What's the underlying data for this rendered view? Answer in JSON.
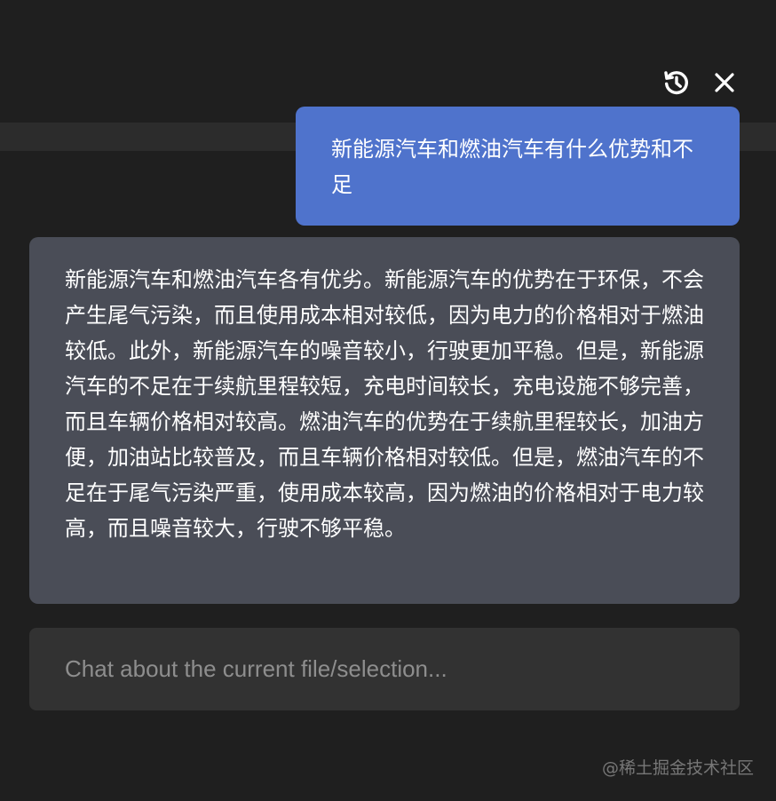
{
  "toolbar": {
    "history_icon": "history-icon",
    "close_icon": "close-icon",
    "icon_color": "#ffffff"
  },
  "messages": [
    {
      "role": "user",
      "text": "新能源汽车和燃油汽车有什么优势和不足"
    },
    {
      "role": "assistant",
      "text": "新能源汽车和燃油汽车各有优劣。新能源汽车的优势在于环保，不会产生尾气污染，而且使用成本相对较低，因为电力的价格相对于燃油较低。此外，新能源汽车的噪音较小，行驶更加平稳。但是，新能源汽车的不足在于续航里程较短，充电时间较长，充电设施不够完善，而且车辆价格相对较高。燃油汽车的优势在于续航里程较长，加油方便，加油站比较普及，而且车辆价格相对较低。但是，燃油汽车的不足在于尾气污染严重，使用成本较高，因为燃油的价格相对于电力较高，而且噪音较大，行驶不够平稳。"
    }
  ],
  "input": {
    "value": "",
    "placeholder": "Chat about the current file/selection..."
  },
  "watermark": "@稀土掘金技术社区",
  "colors": {
    "background": "#1f1f1f",
    "user_bubble": "#4f73cc",
    "assistant_bubble": "#4a4d57",
    "input_background": "#323232"
  }
}
